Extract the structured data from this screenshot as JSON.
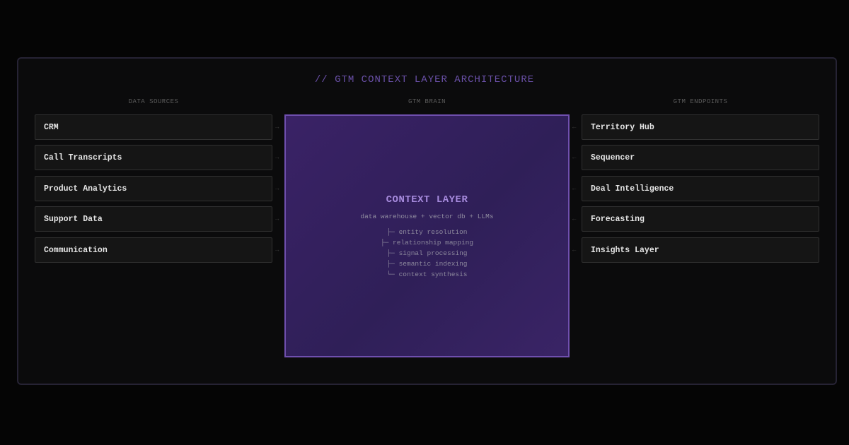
{
  "title": "// GTM CONTEXT LAYER ARCHITECTURE",
  "columns": {
    "sources_heading": "DATA SOURCES",
    "brain_heading": "GTM BRAIN",
    "endpoints_heading": "GTM ENDPOINTS"
  },
  "sources": [
    {
      "label": "CRM"
    },
    {
      "label": "Call Transcripts"
    },
    {
      "label": "Product Analytics"
    },
    {
      "label": "Support Data"
    },
    {
      "label": "Communication"
    }
  ],
  "endpoints": [
    {
      "label": "Territory Hub"
    },
    {
      "label": "Sequencer"
    },
    {
      "label": "Deal Intelligence"
    },
    {
      "label": "Forecasting"
    },
    {
      "label": "Insights Layer"
    }
  ],
  "brain": {
    "title": "CONTEXT LAYER",
    "subtitle": "data warehouse + vector db + LLMs",
    "items": [
      "├─ entity resolution",
      "├─ relationship mapping",
      "├─ signal processing",
      "├─ semantic indexing",
      "└─ context synthesis"
    ]
  },
  "arrows": {
    "in": "→",
    "out": "←"
  },
  "colors": {
    "background": "#050505",
    "frame": "#0b0b0c",
    "accent": "#6f4fae",
    "brain_fill": "#33205e",
    "node_fill": "#151515"
  }
}
